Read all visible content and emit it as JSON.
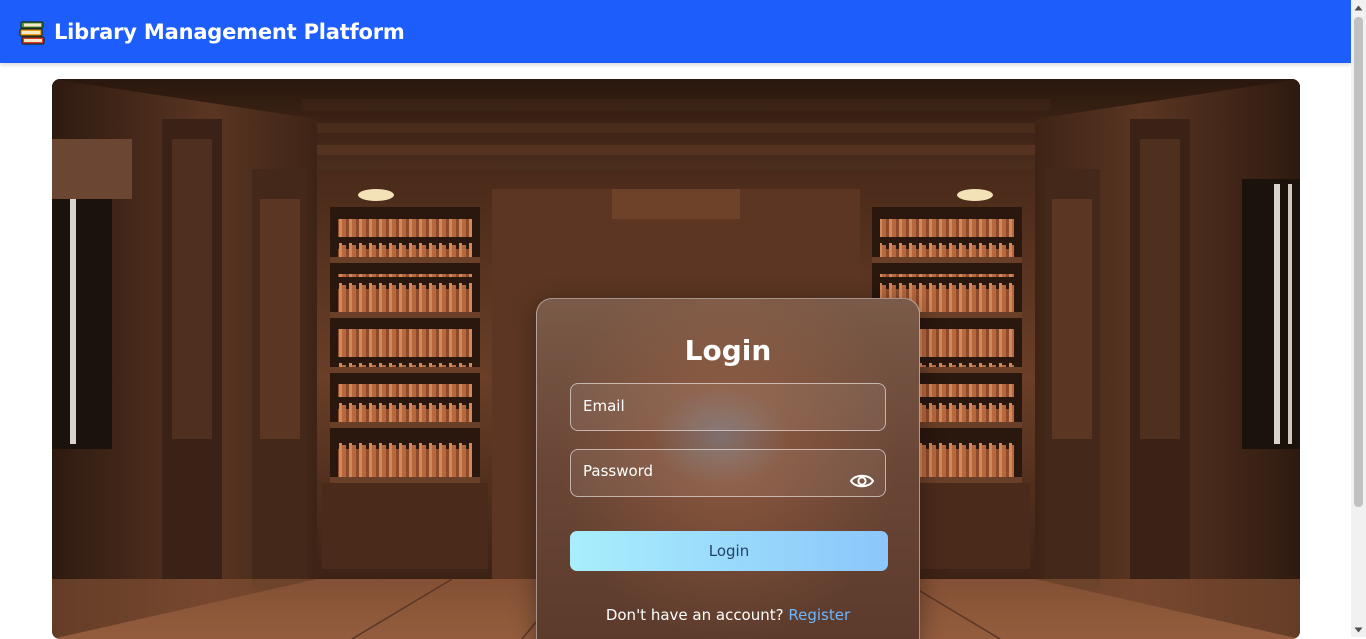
{
  "header": {
    "title": "Library Management Platform",
    "icon": "books-icon",
    "background": "#1c5dfb"
  },
  "login": {
    "title": "Login",
    "email": {
      "placeholder": "Email",
      "value": ""
    },
    "password": {
      "placeholder": "Password",
      "value": ""
    },
    "toggle_icon": "eye-icon",
    "submit_label": "Login",
    "register_prompt": "Don't have an account?",
    "register_link": "Register"
  },
  "colors": {
    "accent": "#1c5dfb",
    "link": "#6bb6ff",
    "button_start": "#a8eefc",
    "button_end": "#8cc6fb"
  }
}
